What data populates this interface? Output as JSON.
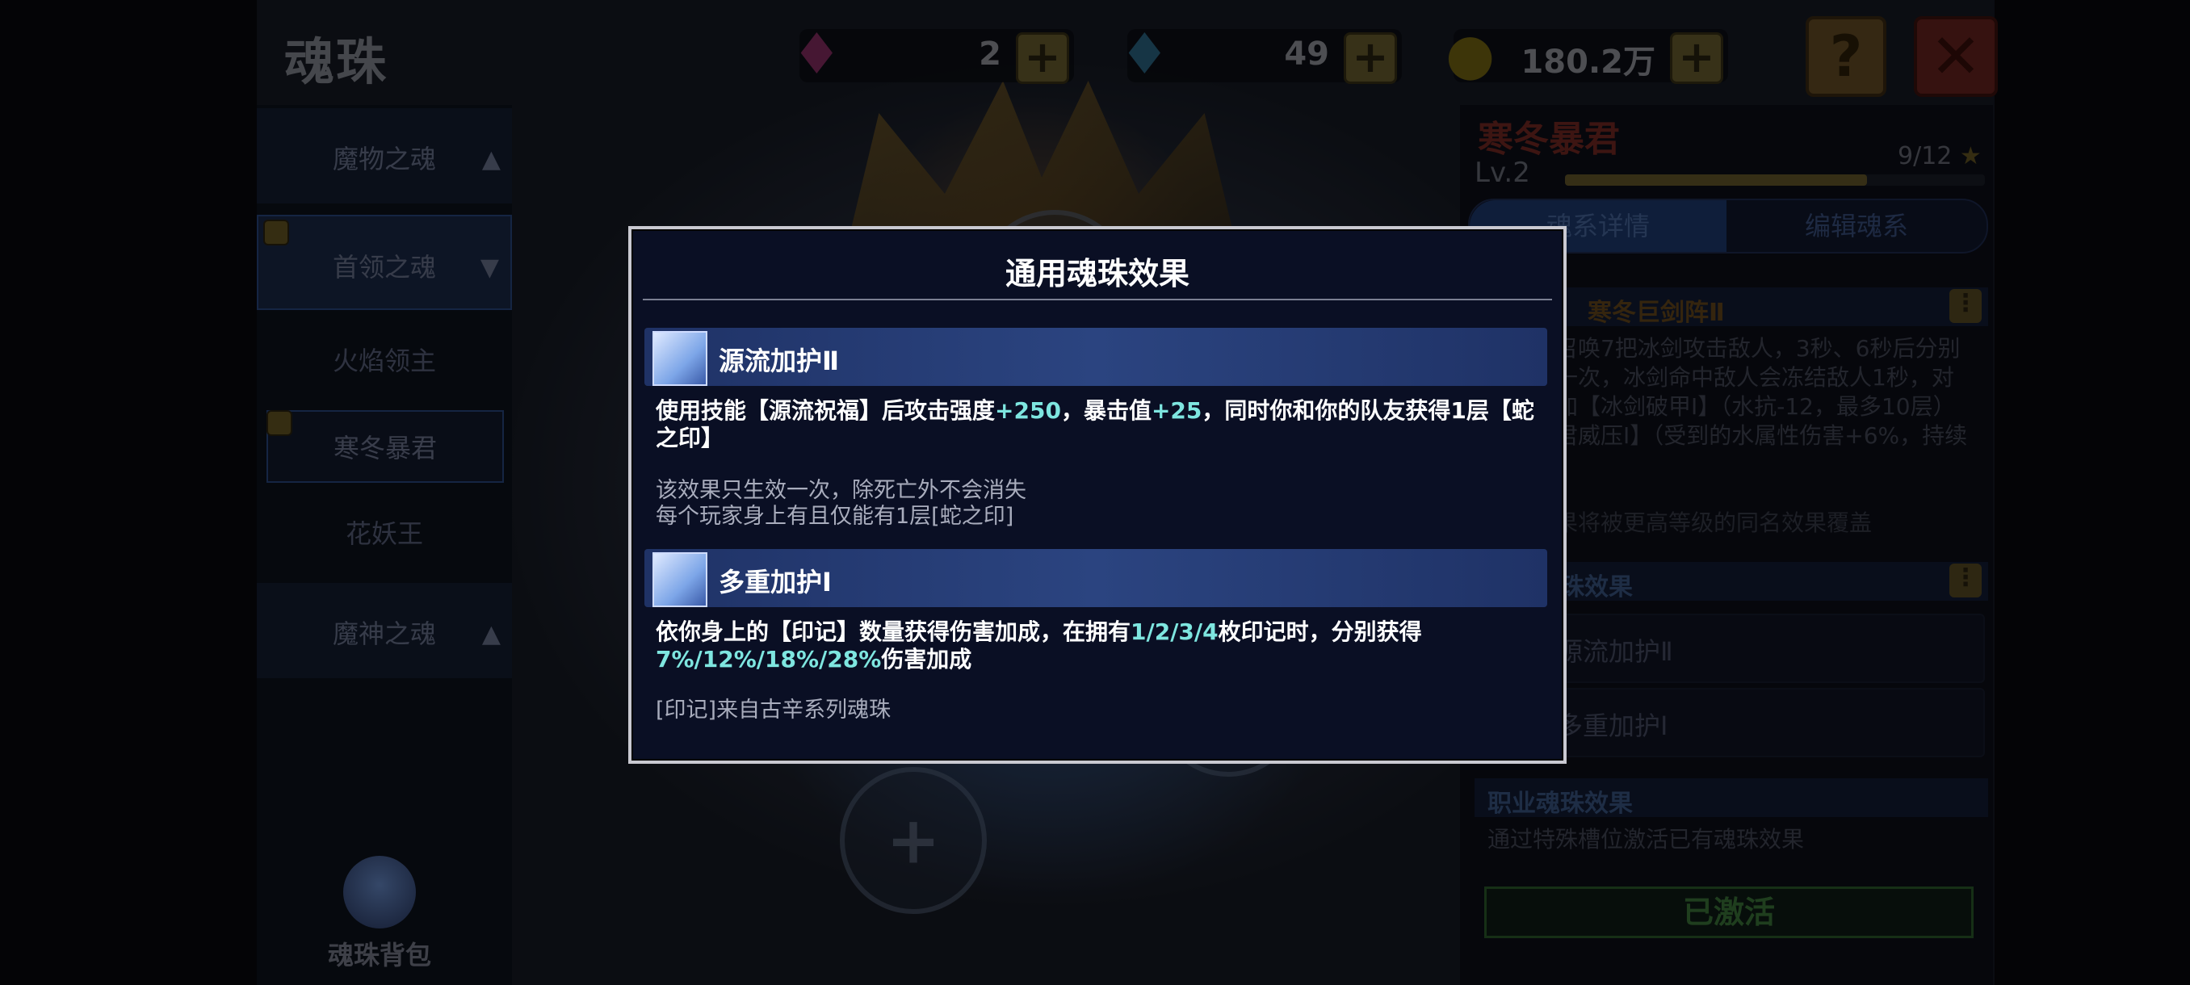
{
  "screen": {
    "title": "魂珠"
  },
  "resources": {
    "pink_gem": {
      "icon": "pink-gem-icon",
      "value": "2"
    },
    "blue_gem": {
      "icon": "blue-gem-icon",
      "value": "49"
    },
    "gold": {
      "icon": "gold-coin-icon",
      "value": "180.2万"
    }
  },
  "sidebar": {
    "groups": [
      {
        "label": "魔物之魂"
      },
      {
        "label": "首领之魂"
      },
      {
        "label": "魔神之魂"
      }
    ],
    "boss_items": [
      {
        "label": "火焰领主"
      },
      {
        "label": "寒冬暴君"
      },
      {
        "label": "花妖王"
      }
    ],
    "bag_label": "魂珠背包"
  },
  "boss_panel": {
    "name": "寒冬暴君",
    "level": "Lv.2",
    "count": "9/12",
    "level_progress": 0.72,
    "tabs": [
      "魂系详情",
      "编辑魂系"
    ],
    "skill_title": "寒冬巨剑阵Ⅱ",
    "skill_text": "在身后召唤7把冰剑攻击敌人，3秒、6秒后分别再召唤一次，冰剑命中敌人会冻结敌人1秒，对目标附加【冰剑破甲Ⅰ】（水抗-12，最多10层）和【暴君威压Ⅰ】（受到的水属性伤害+6%，持续4秒）",
    "override_note": "上述效果将被更高等级的同名效果覆盖",
    "general_title": "通用魂珠效果",
    "general_items": [
      "源流加护Ⅱ",
      "多重加护Ⅰ"
    ],
    "class_title": "职业魂珠效果",
    "class_text": "通过特殊槽位激活已有魂珠效果",
    "activated": "已激活"
  },
  "modal": {
    "title": "通用魂珠效果",
    "effects": [
      {
        "icon": "soul-orb-icon",
        "name": "源流加护Ⅱ",
        "desc_parts": [
          "使用技能【源流祝福】后攻击强度",
          "+250",
          "，暴击值",
          "+25",
          "，同时你和你的队友获得1层【蛇之印】"
        ],
        "notes": [
          "该效果只生效一次，除死亡外不会消失",
          "每个玩家身上有且仅能有1层[蛇之印]"
        ]
      },
      {
        "icon": "soul-orb-icon",
        "name": "多重加护Ⅰ",
        "desc_parts": [
          "依你身上的【印记】数量获得伤害加成，在拥有",
          "1/2/3/4",
          "枚印记时，分别获得",
          "7%/12%/18%/28%",
          "伤害加成"
        ],
        "notes": [
          "[印记]来自古辛系列魂珠"
        ]
      }
    ]
  },
  "colors": {
    "highlight": "#7ee6e0",
    "modal_bg": "#0a0f24",
    "effect_header": "#2b4480"
  }
}
